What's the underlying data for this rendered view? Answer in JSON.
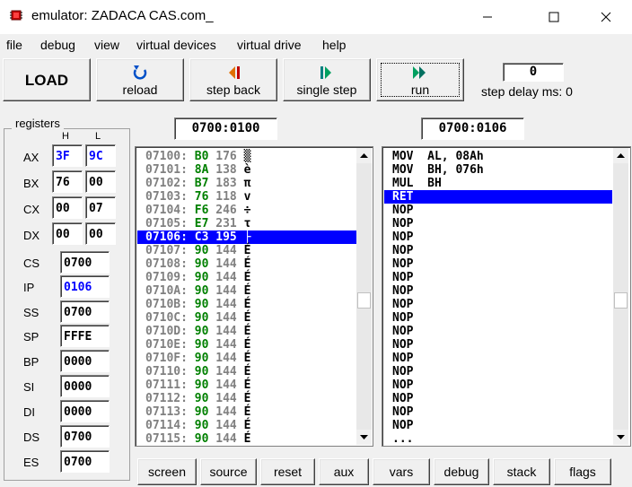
{
  "window": {
    "title": "emulator: ZADACA CAS.com_"
  },
  "menu": [
    "file",
    "debug",
    "view",
    "virtual devices",
    "virtual drive",
    "help"
  ],
  "toolbar": {
    "load": "LOAD",
    "reload": "reload",
    "step_back": "step back",
    "single_step": "single step",
    "run": "run",
    "step_delay_label": "step delay ms: 0",
    "step_delay_value": "0"
  },
  "registers": {
    "title": "registers",
    "h": "H",
    "l": "L",
    "ax": {
      "label": "AX",
      "h": "3F",
      "l": "9C"
    },
    "bx": {
      "label": "BX",
      "h": "76",
      "l": "00"
    },
    "cx": {
      "label": "CX",
      "h": "00",
      "l": "07"
    },
    "dx": {
      "label": "DX",
      "h": "00",
      "l": "00"
    },
    "cs": {
      "label": "CS",
      "value": "0700"
    },
    "ip": {
      "label": "IP",
      "value": "0106"
    },
    "ss": {
      "label": "SS",
      "value": "0700"
    },
    "sp": {
      "label": "SP",
      "value": "FFFE"
    },
    "bp": {
      "label": "BP",
      "value": "0000"
    },
    "si": {
      "label": "SI",
      "value": "0000"
    },
    "di": {
      "label": "DI",
      "value": "0000"
    },
    "ds": {
      "label": "DS",
      "value": "0700"
    },
    "es": {
      "label": "ES",
      "value": "0700"
    }
  },
  "memory_address": "0700:0100",
  "disasm_address": "0700:0106",
  "memory_rows": [
    [
      "07100:",
      "B0",
      "176",
      "▒"
    ],
    [
      "07101:",
      "8A",
      "138",
      "è"
    ],
    [
      "07102:",
      "B7",
      "183",
      "π"
    ],
    [
      "07103:",
      "76",
      "118",
      "v"
    ],
    [
      "07104:",
      "F6",
      "246",
      "÷"
    ],
    [
      "07105:",
      "E7",
      "231",
      "τ"
    ],
    [
      "07106:",
      "C3",
      "195",
      "├"
    ],
    [
      "07107:",
      "90",
      "144",
      "É"
    ],
    [
      "07108:",
      "90",
      "144",
      "É"
    ],
    [
      "07109:",
      "90",
      "144",
      "É"
    ],
    [
      "0710A:",
      "90",
      "144",
      "É"
    ],
    [
      "0710B:",
      "90",
      "144",
      "É"
    ],
    [
      "0710C:",
      "90",
      "144",
      "É"
    ],
    [
      "0710D:",
      "90",
      "144",
      "É"
    ],
    [
      "0710E:",
      "90",
      "144",
      "É"
    ],
    [
      "0710F:",
      "90",
      "144",
      "É"
    ],
    [
      "07110:",
      "90",
      "144",
      "É"
    ],
    [
      "07111:",
      "90",
      "144",
      "É"
    ],
    [
      "07112:",
      "90",
      "144",
      "É"
    ],
    [
      "07113:",
      "90",
      "144",
      "É"
    ],
    [
      "07114:",
      "90",
      "144",
      "É"
    ],
    [
      "07115:",
      "90",
      "144",
      "É"
    ]
  ],
  "memory_selected": 6,
  "disasm_rows": [
    "MOV  AL, 08Ah",
    "MOV  BH, 076h",
    "MUL  BH",
    "RET",
    "NOP",
    "NOP",
    "NOP",
    "NOP",
    "NOP",
    "NOP",
    "NOP",
    "NOP",
    "NOP",
    "NOP",
    "NOP",
    "NOP",
    "NOP",
    "NOP",
    "NOP",
    "NOP",
    "NOP",
    "..."
  ],
  "disasm_selected": 3,
  "bottom_buttons": [
    "screen",
    "source",
    "reset",
    "aux",
    "vars",
    "debug",
    "stack",
    "flags"
  ]
}
